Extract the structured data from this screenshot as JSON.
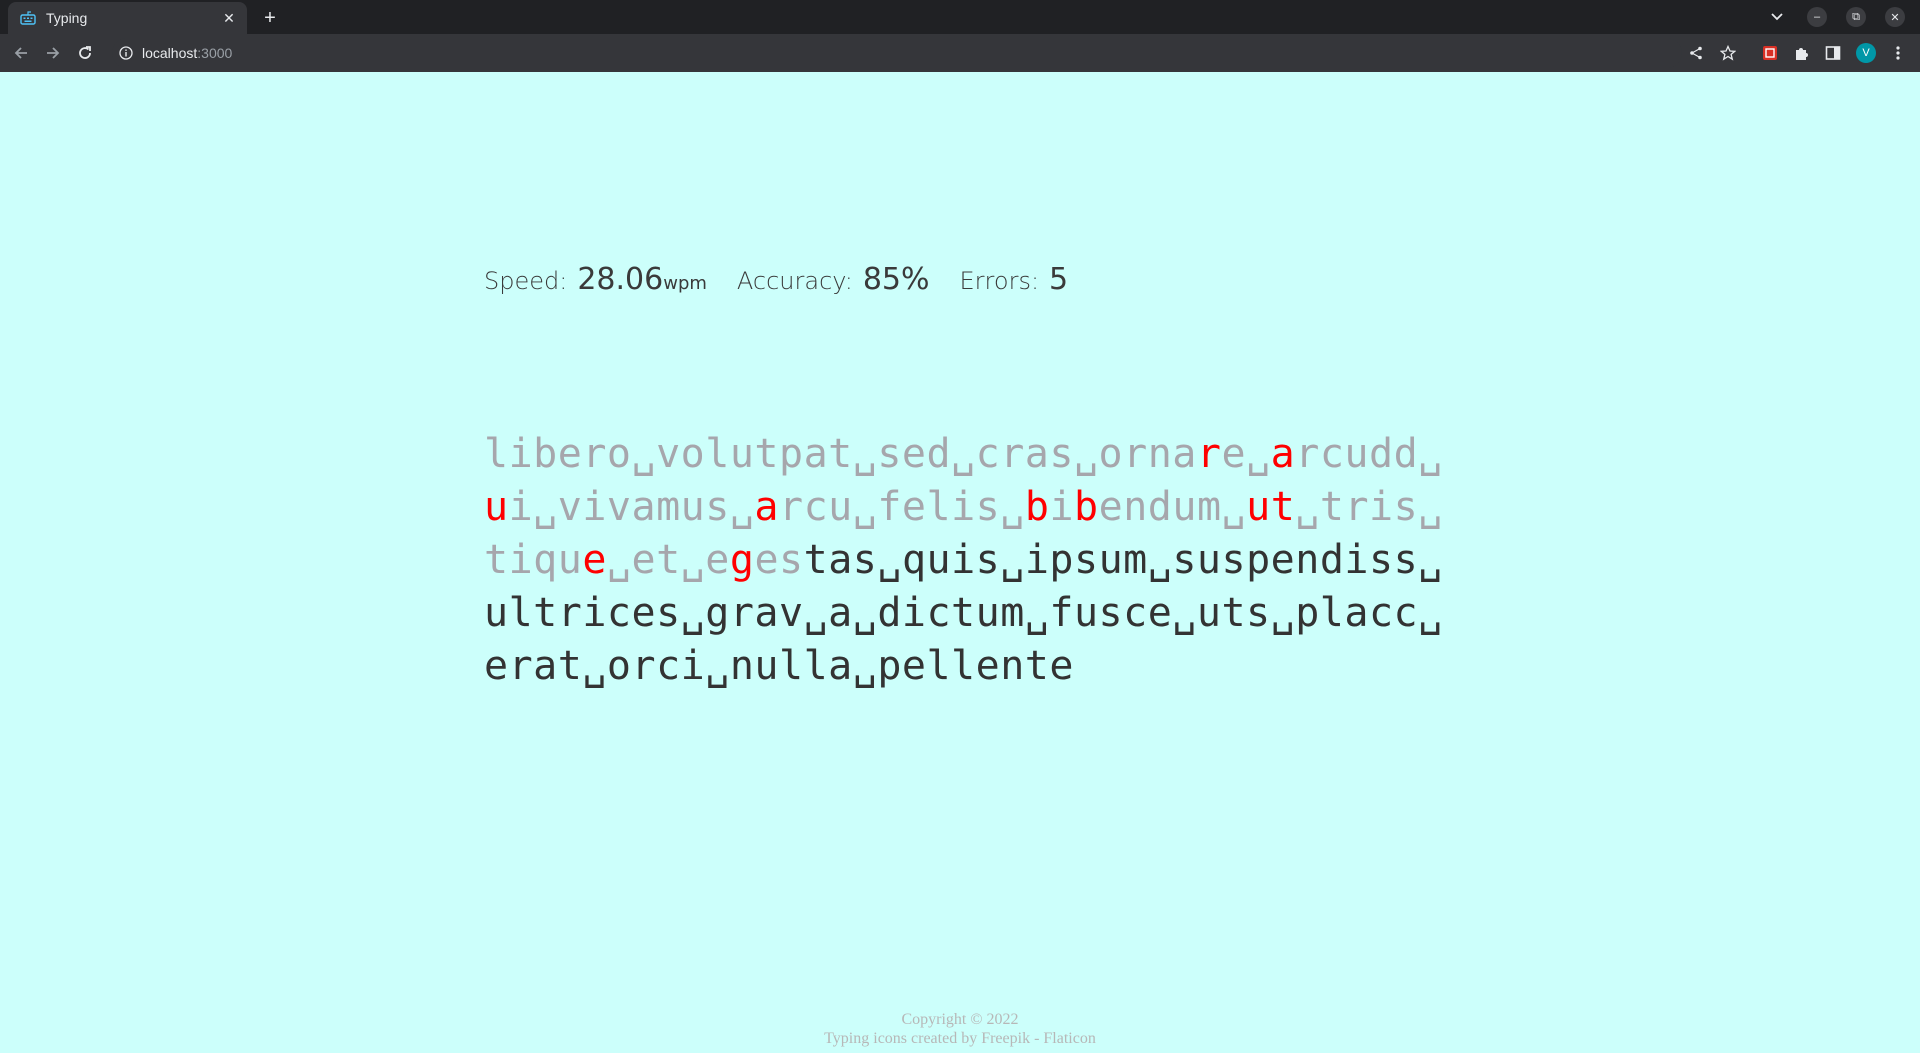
{
  "browser": {
    "tab_title": "Typing",
    "url_host": "localhost",
    "url_port": ":3000",
    "profile_initial": "V"
  },
  "stats": {
    "speed_label": "Speed:",
    "speed_value": "28.06",
    "speed_unit": "wpm",
    "accuracy_label": "Accuracy:",
    "accuracy_value": "85%",
    "errors_label": "Errors:",
    "errors_value": "5"
  },
  "text_lines": [
    [
      {
        "t": "libero␣volutpat␣sed␣cras␣orna",
        "s": "typed"
      },
      {
        "t": "r",
        "s": "err"
      },
      {
        "t": "e␣",
        "s": "typed"
      },
      {
        "t": "a",
        "s": "err"
      },
      {
        "t": "rcudd␣",
        "s": "typed"
      }
    ],
    [
      {
        "t": "u",
        "s": "err"
      },
      {
        "t": "i␣vivamus␣",
        "s": "typed"
      },
      {
        "t": "a",
        "s": "err"
      },
      {
        "t": "rcu␣felis␣",
        "s": "typed"
      },
      {
        "t": "b",
        "s": "err"
      },
      {
        "t": "i",
        "s": "typed"
      },
      {
        "t": "b",
        "s": "err"
      },
      {
        "t": "endum␣",
        "s": "typed"
      },
      {
        "t": "ut",
        "s": "err"
      },
      {
        "t": "␣tris␣",
        "s": "typed"
      }
    ],
    [
      {
        "t": "tiqu",
        "s": "typed"
      },
      {
        "t": "e",
        "s": "err"
      },
      {
        "t": "␣et␣e",
        "s": "typed"
      },
      {
        "t": "g",
        "s": "err"
      },
      {
        "t": "es",
        "s": "typed"
      },
      {
        "t": "tas␣quis␣ipsum␣suspendiss␣",
        "s": "pending"
      }
    ],
    [
      {
        "t": "ultrices␣grav␣a␣dictum␣fusce␣uts␣placc␣",
        "s": "pending"
      }
    ],
    [
      {
        "t": "erat␣orci␣nulla␣pellente",
        "s": "pending"
      }
    ]
  ],
  "footer": {
    "copyright": "Copyright © 2022",
    "credit": "Typing icons created by Freepik - Flaticon"
  },
  "colors": {
    "background": "#ccfffb",
    "typed": "#a6a6ac",
    "error": "#ff0000",
    "pending": "#333333"
  }
}
